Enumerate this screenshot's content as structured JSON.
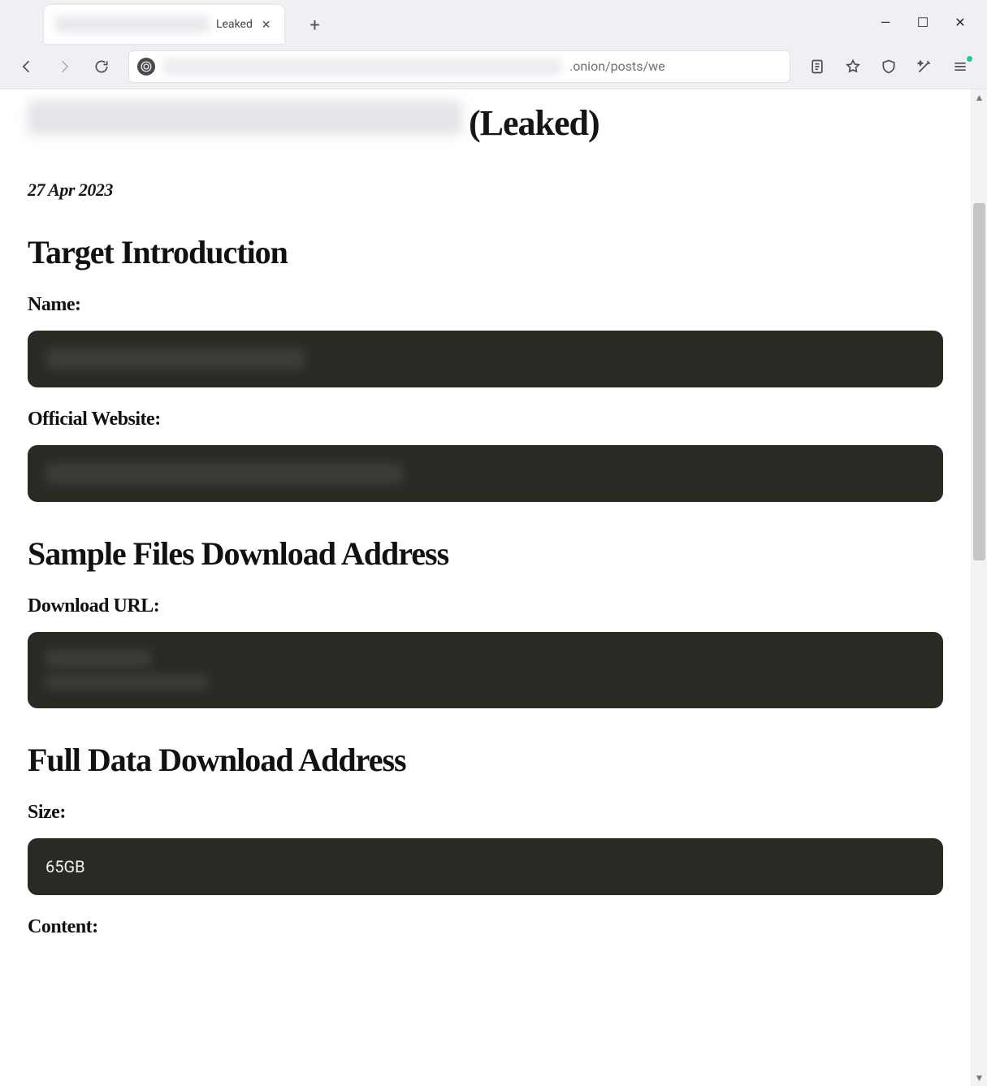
{
  "browser": {
    "tab": {
      "title_visible_suffix": "Leaked",
      "close_label": "×"
    },
    "new_tab_label": "+",
    "window_controls": {
      "minimize": "—",
      "maximize": "☐",
      "close": "✕"
    },
    "url_visible_suffix": ".onion/posts/we"
  },
  "post": {
    "title_suffix": "(Leaked)",
    "date": "27 Apr 2023",
    "sections": {
      "intro_heading": "Target Introduction",
      "name_label": "Name:",
      "website_label": "Official Website:",
      "sample_heading": "Sample Files Download Address",
      "download_url_label": "Download URL:",
      "full_heading": "Full Data Download Address",
      "size_label": "Size:",
      "size_value": "65GB",
      "content_label": "Content:"
    }
  }
}
